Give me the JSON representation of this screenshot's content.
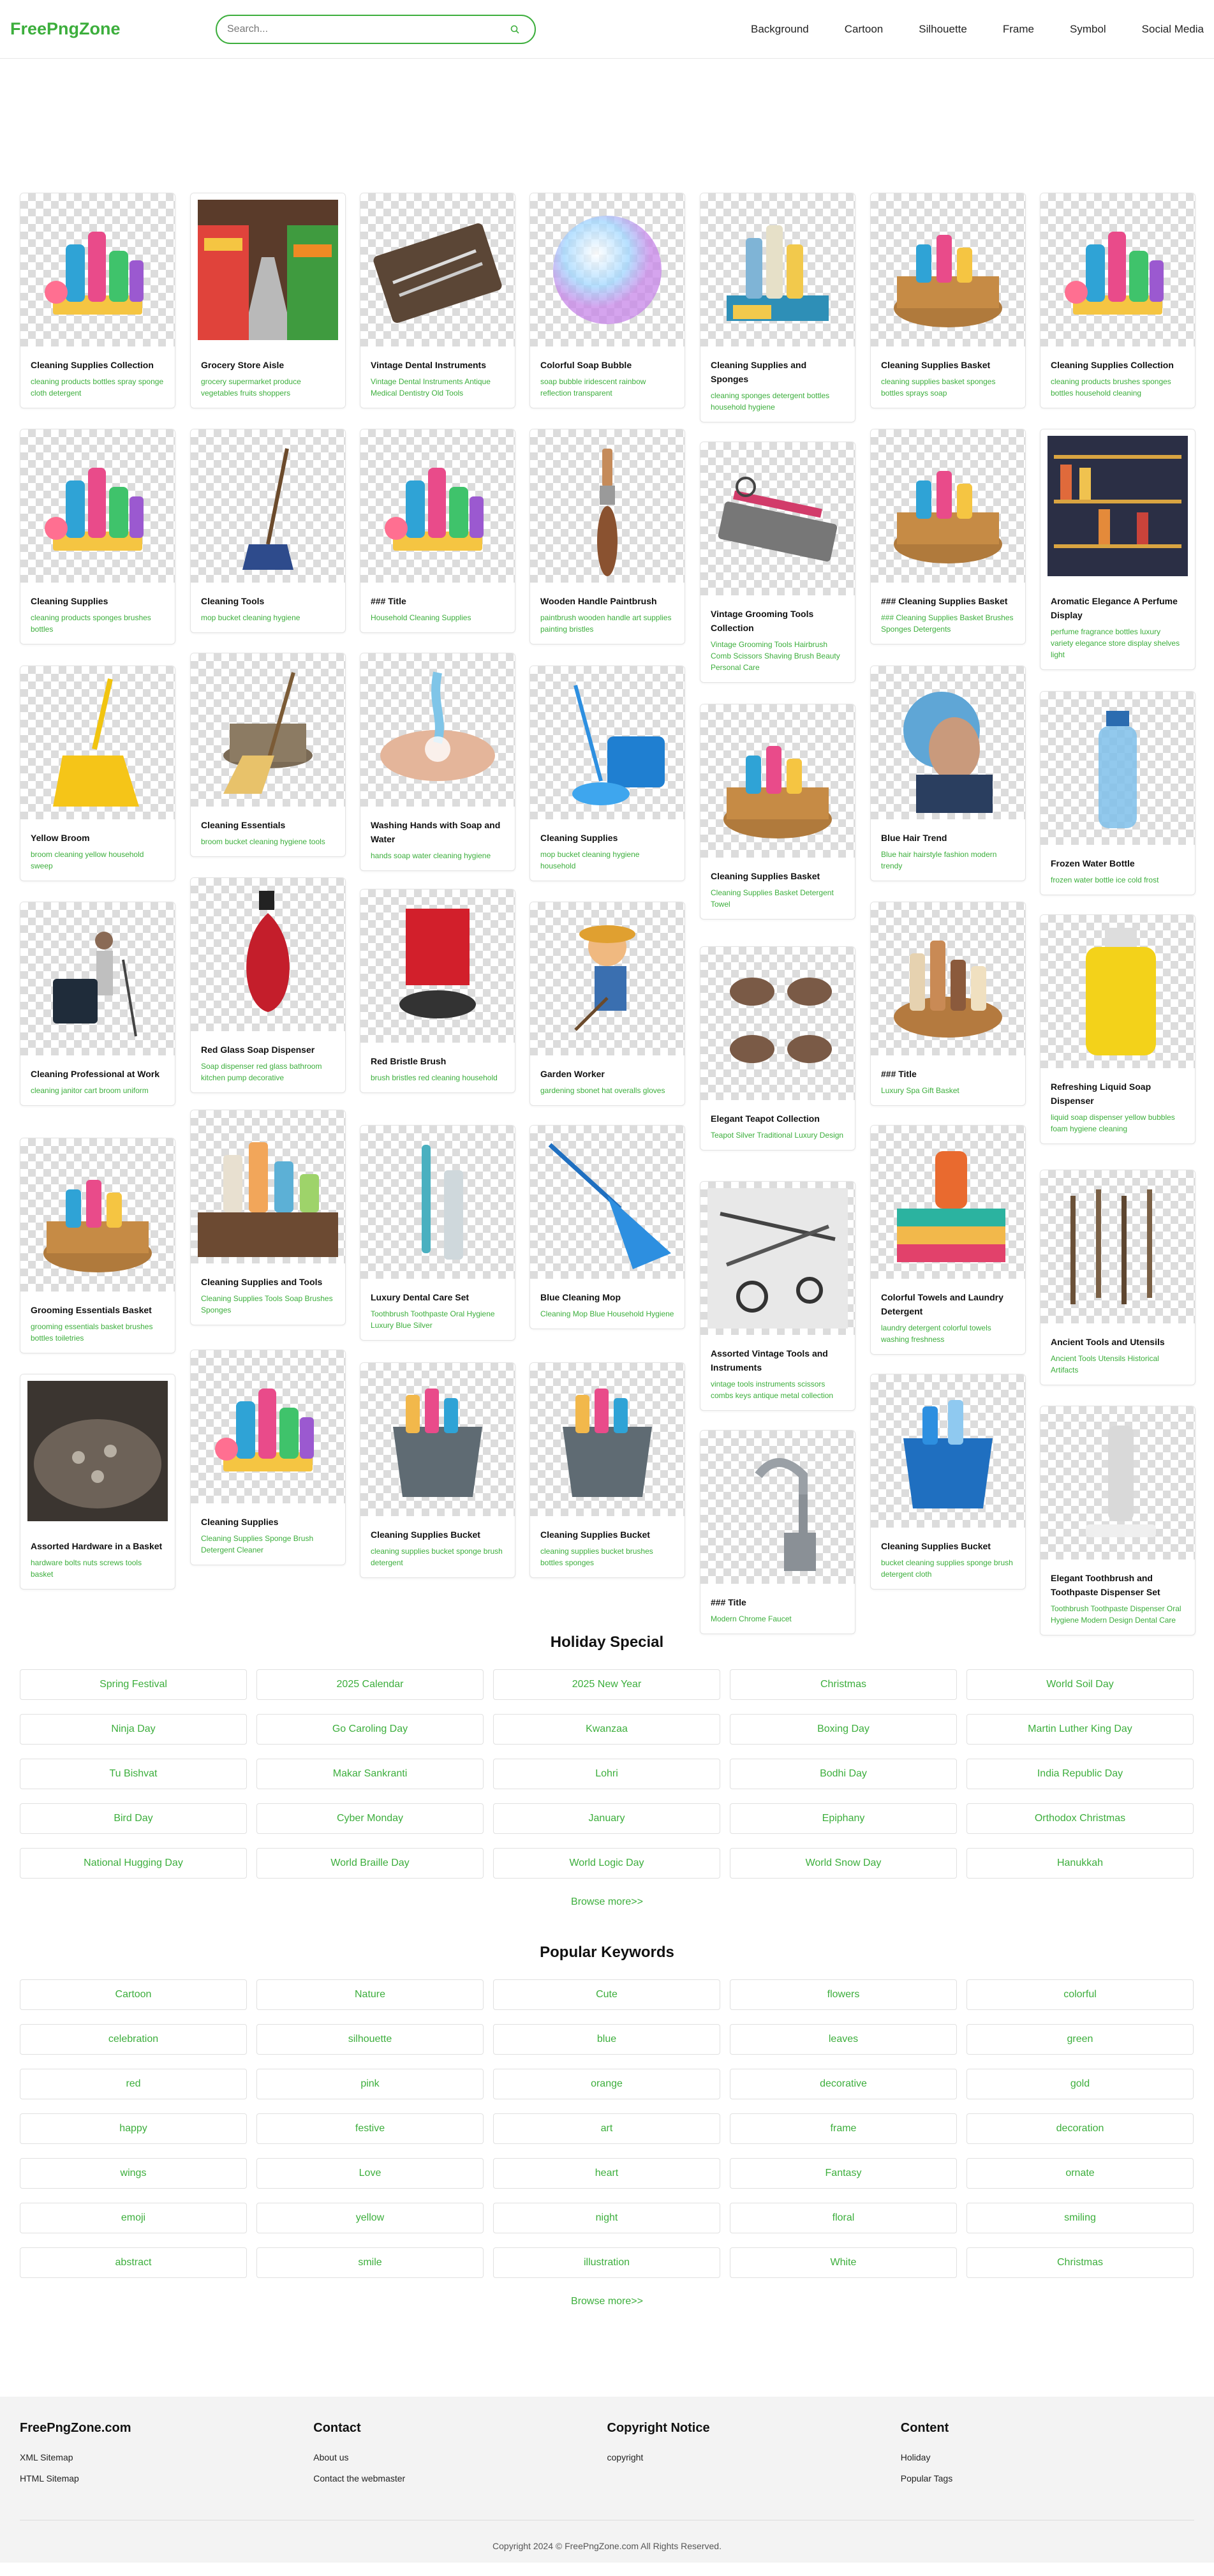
{
  "header": {
    "logo": "FreePngZone",
    "search_placeholder": "Search...",
    "nav": [
      "Background",
      "Cartoon",
      "Silhouette",
      "Frame",
      "Symbol",
      "Social Media"
    ]
  },
  "cards": [
    {
      "title": "Cleaning Supplies Collection",
      "tags": "cleaning products bottles spray sponge cloth detergent",
      "icon": "cleaning-bottles-icon",
      "photo": false
    },
    {
      "title": "Grocery Store Aisle",
      "tags": "grocery supermarket produce vegetables fruits shoppers",
      "icon": "grocery-aisle-icon",
      "photo": true
    },
    {
      "title": "Vintage Dental Instruments",
      "tags": "Vintage Dental Instruments Antique Medical Dentistry Old Tools",
      "icon": "dental-tools-icon",
      "photo": false
    },
    {
      "title": "Colorful Soap Bubble",
      "tags": "soap bubble iridescent rainbow reflection transparent",
      "icon": "soap-bubble-icon",
      "photo": false
    },
    {
      "title": "Cleaning Supplies and Sponges",
      "tags": "cleaning sponges detergent bottles household hygiene",
      "icon": "cleaning-sponges-icon",
      "photo": false
    },
    {
      "title": "Cleaning Supplies Basket",
      "tags": "cleaning supplies basket sponges bottles sprays soap",
      "icon": "supplies-basket-icon",
      "photo": false
    },
    {
      "title": "Cleaning Supplies Collection",
      "tags": "cleaning products brushes sponges bottles household cleaning",
      "icon": "cleaning-bottles-icon",
      "photo": false
    },
    {
      "title": "Cleaning Supplies",
      "tags": "cleaning products sponges brushes bottles",
      "icon": "cleaning-bottles-icon",
      "photo": false
    },
    {
      "title": "Cleaning Tools",
      "tags": "mop bucket cleaning hygiene",
      "icon": "broom-icon",
      "photo": false
    },
    {
      "title": "### Title",
      "tags": "Household Cleaning Supplies",
      "icon": "cleaning-bottles-icon",
      "photo": false
    },
    {
      "title": "Wooden Handle Paintbrush",
      "tags": "paintbrush wooden handle art supplies painting bristles",
      "icon": "paintbrush-icon",
      "photo": false
    },
    {
      "title": "Vintage Grooming Tools Collection",
      "tags": "Vintage Grooming Tools Hairbrush Comb Scissors Shaving Brush Beauty Personal Care",
      "icon": "grooming-tools-icon",
      "photo": false
    },
    {
      "title": "### Cleaning Supplies Basket",
      "tags": "### Cleaning Supplies Basket Brushes Sponges Detergents",
      "icon": "supplies-basket-icon",
      "photo": false
    },
    {
      "title": "Aromatic Elegance A Perfume Display",
      "tags": "perfume fragrance bottles luxury variety elegance store display shelves light",
      "icon": "perfume-shelf-icon",
      "photo": true
    },
    {
      "title": "Yellow Broom",
      "tags": "broom cleaning yellow household sweep",
      "icon": "yellow-broom-icon",
      "photo": false
    },
    {
      "title": "Cleaning Essentials",
      "tags": "broom bucket cleaning hygiene tools",
      "icon": "broom-bucket-icon",
      "photo": false
    },
    {
      "title": "Washing Hands with Soap and Water",
      "tags": "hands soap water cleaning hygiene",
      "icon": "washing-hands-icon",
      "photo": false
    },
    {
      "title": "Cleaning Supplies",
      "tags": "mop bucket cleaning hygiene household",
      "icon": "mop-bucket-icon",
      "photo": false
    },
    {
      "title": "Cleaning Supplies Basket",
      "tags": "Cleaning Supplies Basket Detergent Towel",
      "icon": "supplies-basket-icon",
      "photo": false
    },
    {
      "title": "Blue Hair Trend",
      "tags": "Blue hair hairstyle fashion modern trendy",
      "icon": "blue-hair-icon",
      "photo": false
    },
    {
      "title": "Frozen Water Bottle",
      "tags": "frozen water bottle ice cold frost",
      "icon": "water-bottle-icon",
      "photo": false
    },
    {
      "title": "Cleaning Professional at Work",
      "tags": "cleaning janitor cart broom uniform",
      "icon": "janitor-icon",
      "photo": false
    },
    {
      "title": "Red Glass Soap Dispenser",
      "tags": "Soap dispenser red glass bathroom kitchen pump decorative",
      "icon": "red-dispenser-icon",
      "photo": false
    },
    {
      "title": "Red Bristle Brush",
      "tags": "brush bristles red cleaning household",
      "icon": "red-brush-icon",
      "photo": false
    },
    {
      "title": "Garden Worker",
      "tags": "gardening sbonet hat overalls gloves",
      "icon": "garden-worker-icon",
      "photo": false
    },
    {
      "title": "Elegant Teapot Collection",
      "tags": "Teapot Silver Traditional Luxury Design",
      "icon": "teapot-icon",
      "photo": false
    },
    {
      "title": "### Title",
      "tags": "Luxury Spa Gift Basket",
      "icon": "spa-basket-icon",
      "photo": false
    },
    {
      "title": "Refreshing Liquid Soap Dispenser",
      "tags": "liquid soap dispenser yellow bubbles foam hygiene cleaning",
      "icon": "yellow-soap-icon",
      "photo": false
    },
    {
      "title": "Grooming Essentials Basket",
      "tags": "grooming essentials basket brushes bottles toiletries",
      "icon": "supplies-basket-icon",
      "photo": false
    },
    {
      "title": "Cleaning Supplies and Tools",
      "tags": "Cleaning Supplies Tools Soap Brushes Sponges",
      "icon": "cleaning-table-icon",
      "photo": false
    },
    {
      "title": "Luxury Dental Care Set",
      "tags": "Toothbrush Toothpaste Oral Hygiene Luxury Blue Silver",
      "icon": "toothbrush-icon",
      "photo": false
    },
    {
      "title": "Blue Cleaning Mop",
      "tags": "Cleaning Mop Blue Household Hygiene",
      "icon": "blue-mop-icon",
      "photo": false
    },
    {
      "title": "Assorted Vintage Tools and Instruments",
      "tags": "vintage tools instruments scissors combs keys antique metal collection",
      "icon": "vintage-tools-icon",
      "photo": false
    },
    {
      "title": "Colorful Towels and Laundry Detergent",
      "tags": "laundry detergent colorful towels washing freshness",
      "icon": "towels-icon",
      "photo": false
    },
    {
      "title": "Ancient Tools and Utensils",
      "tags": "Ancient Tools Utensils Historical Artifacts",
      "icon": "ancient-tools-icon",
      "photo": false
    },
    {
      "title": "Assorted Hardware in a Basket",
      "tags": "hardware bolts nuts screws tools basket",
      "icon": "hardware-basket-icon",
      "photo": true
    },
    {
      "title": "Cleaning Supplies",
      "tags": "Cleaning Supplies Sponge Brush Detergent Cleaner",
      "icon": "cleaning-bottles-icon",
      "photo": false
    },
    {
      "title": "Cleaning Supplies Bucket",
      "tags": "cleaning supplies bucket sponge brush detergent",
      "icon": "supplies-bucket-icon",
      "photo": false
    },
    {
      "title": "Cleaning Supplies Bucket",
      "tags": "cleaning supplies bucket brushes bottles sponges",
      "icon": "supplies-bucket-icon",
      "photo": false
    },
    {
      "title": "### Title",
      "tags": "Modern Chrome Faucet",
      "icon": "faucet-icon",
      "photo": false
    },
    {
      "title": "Cleaning Supplies Bucket",
      "tags": "bucket cleaning supplies sponge brush detergent cloth",
      "icon": "blue-bucket-icon",
      "photo": false
    },
    {
      "title": "Elegant Toothbrush and Toothpaste Dispenser Set",
      "tags": "Toothbrush Toothpaste Dispenser Oral Hygiene Modern Design Dental Care",
      "icon": "toothbrush-set-icon",
      "photo": false
    }
  ],
  "holiday": {
    "title": "Holiday Special",
    "items": [
      "Spring Festival",
      "2025 Calendar",
      "2025 New Year",
      "Christmas",
      "World Soil Day",
      "Ninja Day",
      "Go Caroling Day",
      "Kwanzaa",
      "Boxing Day",
      "Martin Luther King Day",
      "Tu Bishvat",
      "Makar Sankranti",
      "Lohri",
      "Bodhi Day",
      "India Republic Day",
      "Bird Day",
      "Cyber Monday",
      "January",
      "Epiphany",
      "Orthodox Christmas",
      "National Hugging Day",
      "World Braille Day",
      "World Logic Day",
      "World Snow Day",
      "Hanukkah"
    ],
    "more": "Browse more>>"
  },
  "keywords": {
    "title": "Popular Keywords",
    "items": [
      "Cartoon",
      "Nature",
      "Cute",
      "flowers",
      "colorful",
      "celebration",
      "silhouette",
      "blue",
      "leaves",
      "green",
      "red",
      "pink",
      "orange",
      "decorative",
      "gold",
      "happy",
      "festive",
      "art",
      "frame",
      "decoration",
      "wings",
      "Love",
      "heart",
      "Fantasy",
      "ornate",
      "emoji",
      "yellow",
      "night",
      "floral",
      "smiling",
      "abstract",
      "smile",
      "illustration",
      "White",
      "Christmas"
    ],
    "more": "Browse more>>"
  },
  "footer": {
    "cols": [
      {
        "title": "FreePngZone.com",
        "links": [
          "XML Sitemap",
          "HTML Sitemap"
        ]
      },
      {
        "title": "Contact",
        "links": [
          "About us",
          "Contact the webmaster"
        ]
      },
      {
        "title": "Copyright Notice",
        "links": [
          "copyright"
        ]
      },
      {
        "title": "Content",
        "links": [
          "Holiday",
          "Popular Tags"
        ]
      }
    ],
    "copyright": "Copyright 2024 © FreePngZone.com All Rights Reserved."
  },
  "colors": {
    "accent": "#3cae3c"
  }
}
